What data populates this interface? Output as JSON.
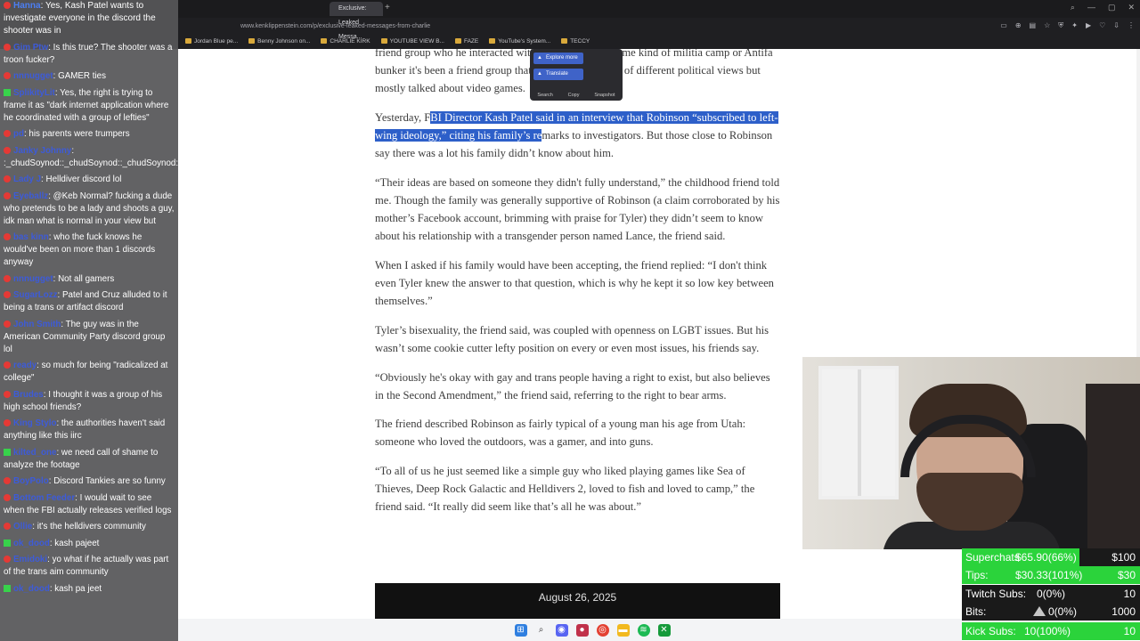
{
  "browser": {
    "tabs": [
      "Exclusive: Leaked Messa..."
    ],
    "url": "www.kenklippenstein.com/p/exclusive-leaked-messages-from-charlie",
    "bookmarks": [
      "Jordan Blue pe...",
      "Benny Johnson on...",
      "CHARLIE KIRK",
      "YOUTUBE VIEW B...",
      "FAZE",
      "YouTube's System...",
      "TECCY"
    ]
  },
  "selection_popup": {
    "explore_label": "Explore more",
    "translate_label": "Translate",
    "search_label": "Search",
    "copy_label": "Copy",
    "snapshot_label": "Snapshot"
  },
  "article": {
    "p0": "friend group who he interacted with was either from some kind of militia camp or Antifa bunker it's been a friend group that represented a range of different political views but mostly talked about video games.",
    "p1_pre": "Yesterday, F",
    "p1_hl": "BI Director Kash Patel said in an interview that Robinson “subscribed to left-wing ideology,” citing his family’s re",
    "p1_post": "marks to investigators. But those close to Robinson say there was a lot his family didn’t know about him.",
    "p2": "“Their ideas are based on someone they didn't fully understand,” the childhood friend told me. Though the family was generally supportive of Robinson (a claim corroborated by his mother’s Facebook account, brimming with praise for Tyler) they didn’t seem to know about his relationship with a transgender person named Lance, the friend said.",
    "p3": "When I asked if his family would have been accepting, the friend replied: “I don't think even Tyler knew the answer to that question, which is why he kept it so low key between themselves.”",
    "p4": "Tyler’s bisexuality, the friend said, was coupled with openness on LGBT issues. But his wasn’t some cookie cutter lefty position on every or even most issues, his friends say.",
    "p5": "“Obviously he's okay with gay and trans people having a right to exist, but also believes in the Second Amendment,” the friend said, referring to the right to bear arms.",
    "p6": "The friend described Robinson as fairly typical of a young man his age from Utah: someone who loved the outdoors, was a gamer, and into guns.",
    "p7": "“To all of us he just seemed like a simple guy who liked playing games like Sea of Thieves, Deep Rock Galactic and Helldivers 2, loved to fish and loved to camp,” the friend said. “It really did seem like that’s all he was about.”",
    "date_caption": "August 26, 2025"
  },
  "chat": [
    {
      "badge": "yt",
      "user": "Hanna",
      "text": "Yes, Kash Patel wants to investigate everyone in the discord the shooter was in"
    },
    {
      "badge": "yt",
      "user": "Gim Ptw",
      "text": "Is this true? The shooter was a troon fucker?"
    },
    {
      "badge": "yt",
      "user": "nnnugget",
      "text": "GAMER ties"
    },
    {
      "badge": "kick",
      "user": "SplikityLit",
      "text": "Yes, the right is trying to frame it as \"dark internet application where he coordinated with a group of lefties\""
    },
    {
      "badge": "yt",
      "user": "pd",
      "text": "his parents were trumpers"
    },
    {
      "badge": "yt",
      "user": "Janky Johnny",
      "text": ":_chudSoynod::_chudSoynod::_chudSoynod::_chudSoynod:"
    },
    {
      "badge": "yt",
      "user": "Lady J",
      "text": "Helldiver discord lol"
    },
    {
      "badge": "yt",
      "user": "Eyeballz",
      "text": "@Keb Normal? fucking a dude who pretends to be a lady and shoots a guy, idk man what is normal in your view but"
    },
    {
      "badge": "yt",
      "user": "bas kinn",
      "text": "who the fuck knows he would've been on more than 1 discords anyway"
    },
    {
      "badge": "yt",
      "user": "nnnugget",
      "text": "Not all gamers"
    },
    {
      "badge": "yt",
      "user": "SugarLozz",
      "text": "Patel and Cruz alluded to it being a trans or artifact discord"
    },
    {
      "badge": "yt",
      "user": "John Smith",
      "text": "The guy was in the American Community Party discord group lol"
    },
    {
      "badge": "yt",
      "user": "ready",
      "text": "so much for being \"radicalized at college\""
    },
    {
      "badge": "yt",
      "user": "Brudes",
      "text": "I thought it was a group of his high school friends?"
    },
    {
      "badge": "yt",
      "user": "King Stylo",
      "text": "the authorities haven't said anything like this iirc"
    },
    {
      "badge": "kick",
      "user": "kilted_one",
      "text": "we need call of shame to analyze the footage"
    },
    {
      "badge": "yt",
      "user": "BoyPolo",
      "text": "Discord Tankies are so funny"
    },
    {
      "badge": "yt",
      "user": "Bottom Feeder",
      "text": "I would wait to see when the FBI actually releases verified logs"
    },
    {
      "badge": "yt",
      "user": "Ollie",
      "text": "it's the helldivers community"
    },
    {
      "badge": "kick",
      "user": "ok_dood",
      "text": "kash pajeet"
    },
    {
      "badge": "yt",
      "user": "Emidoki",
      "text": "yo what if he actually was part of the trans aim community"
    },
    {
      "badge": "kick",
      "user": "ok_dood",
      "text": "kash pa jeet"
    }
  ],
  "goals": [
    {
      "label": "Superchats",
      "current": "$65.90(66%)",
      "target": "$100",
      "progress": 0.66
    },
    {
      "label": "Tips:",
      "current": "$30.33(101%)",
      "target": "$30",
      "progress": 1.0
    },
    {
      "label": "Twitch Subs:",
      "current": "0(0%)",
      "target": "10",
      "progress": 0
    },
    {
      "label": "Bits:",
      "current": "0(0%)",
      "target": "1000",
      "progress": 0
    },
    {
      "label": "Kick Subs:",
      "current": "10(100%)",
      "target": "10",
      "progress": 1.0
    }
  ],
  "colors": {
    "selection": "#2d5fc9",
    "goal_fill": "#2bd33b",
    "chat_bg": "#565658",
    "youtube_badge": "#e53935",
    "kick_badge": "#38d24b"
  },
  "taskbar_icons": [
    "windows-start-icon",
    "search-icon",
    "discord-icon",
    "obs-icon",
    "chrome-icon",
    "file-explorer-icon",
    "spotify-icon",
    "xbox-icon"
  ]
}
